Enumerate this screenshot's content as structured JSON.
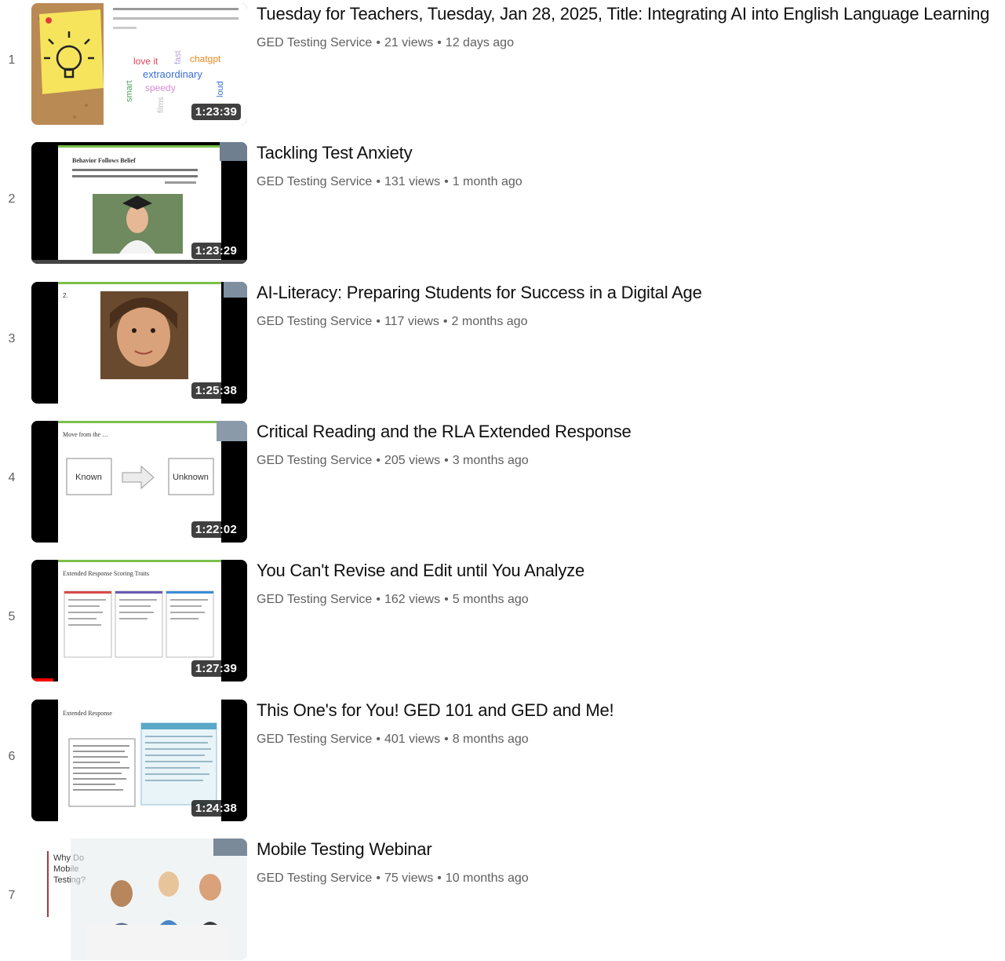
{
  "videos": [
    {
      "index": "1",
      "title": "Tuesday for Teachers, Tuesday, Jan 28, 2025, Title: Integrating AI into English Language Learning",
      "channel": "GED Testing Service",
      "views": "21 views",
      "age": "12 days ago",
      "duration": "1:23:39",
      "thumb": {
        "words": [
          "love it",
          "chatgpt",
          "extraordinary",
          "speedy",
          "smart",
          "fast",
          "loud",
          "films"
        ]
      }
    },
    {
      "index": "2",
      "title": "Tackling Test Anxiety",
      "channel": "GED Testing Service",
      "views": "131 views",
      "age": "1 month ago",
      "duration": "1:23:29",
      "thumb": {
        "heading": "Behavior Follows Belief",
        "quote": "“In life, behavior follows belief. Everything we do is directly connected to what we believe is true.”",
        "attribution": "- John Strange"
      }
    },
    {
      "index": "3",
      "title": "AI-Literacy: Preparing Students for Success in a Digital Age",
      "channel": "GED Testing Service",
      "views": "117 views",
      "age": "2 months ago",
      "duration": "1:25:38",
      "thumb": {
        "slide_number": "2."
      }
    },
    {
      "index": "4",
      "title": "Critical Reading and the RLA Extended Response",
      "channel": "GED Testing Service",
      "views": "205 views",
      "age": "3 months ago",
      "duration": "1:22:02",
      "thumb": {
        "heading": "Move from the …",
        "left_box": "Known",
        "right_box": "Unknown"
      }
    },
    {
      "index": "5",
      "title": "You Can't Revise and Edit until You Analyze",
      "channel": "GED Testing Service",
      "views": "162 views",
      "age": "5 months ago",
      "duration": "1:27:39",
      "watched_fraction": 0.1,
      "thumb": {
        "heading": "Extended Response Scoring Traits"
      }
    },
    {
      "index": "6",
      "title": "This One's for You! GED 101 and GED and Me!",
      "channel": "GED Testing Service",
      "views": "401 views",
      "age": "8 months ago",
      "duration": "1:24:38",
      "thumb": {
        "heading": "Extended Response"
      }
    },
    {
      "index": "7",
      "title": "Mobile Testing Webinar",
      "channel": "GED Testing Service",
      "views": "75 views",
      "age": "10 months ago",
      "duration": "",
      "thumb": {
        "caption": "Why Do Mobile Testing?"
      }
    }
  ],
  "meta_separator": "•",
  "colors": {
    "progress": "#ff0000",
    "slide_accent": "#7cc04a"
  }
}
